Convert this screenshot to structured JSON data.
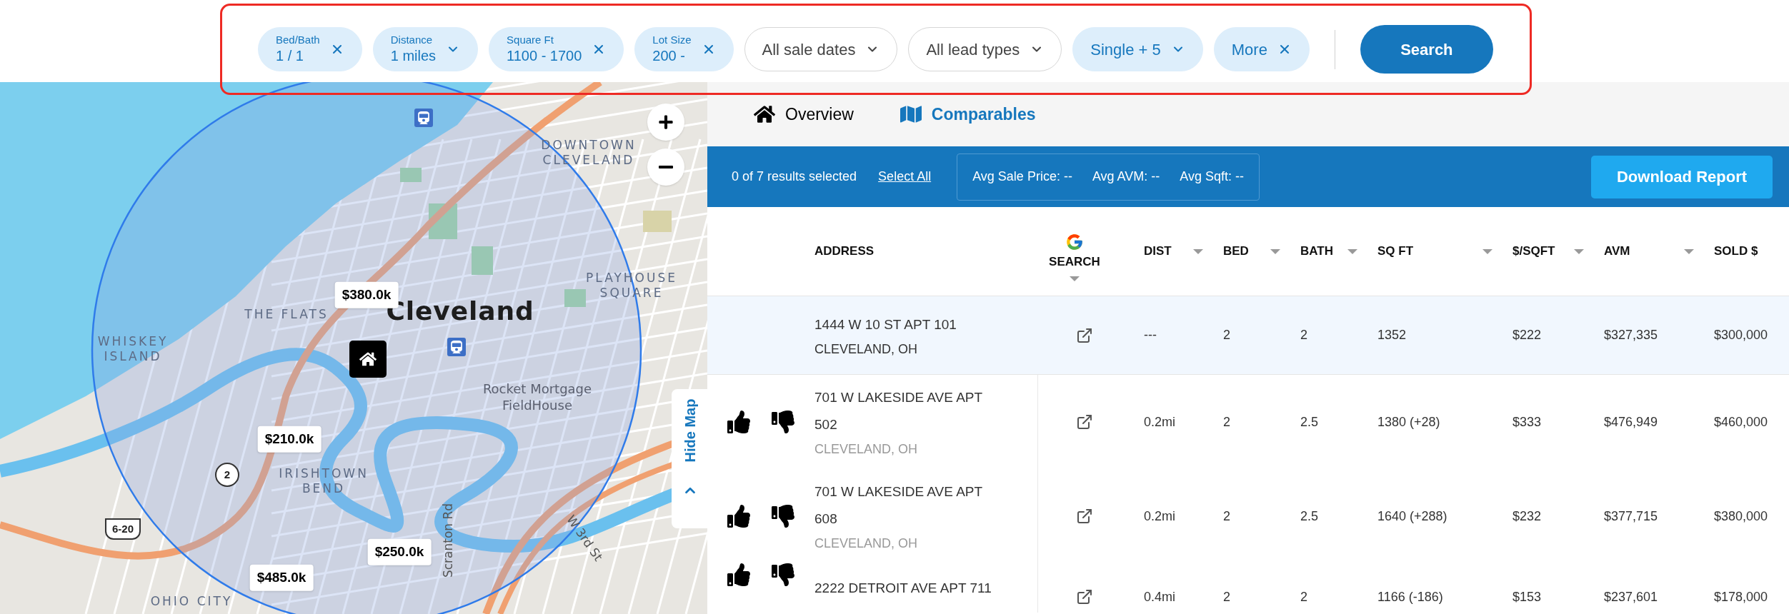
{
  "filters": [
    {
      "kind": "range",
      "label": "Bed/Bath",
      "value": "1 / 1",
      "active": true
    },
    {
      "kind": "picker",
      "label": "Distance",
      "value": "1 miles",
      "active": true
    },
    {
      "kind": "range",
      "label": "Square Ft",
      "value": "1100 - 1700",
      "active": true
    },
    {
      "kind": "range",
      "label": "Lot Size",
      "value": "200 -",
      "active": true
    },
    {
      "kind": "dropdown",
      "value": "All sale dates",
      "active": false
    },
    {
      "kind": "dropdown",
      "value": "All lead types",
      "active": false
    },
    {
      "kind": "dropdown",
      "value": "Single  + 5",
      "active": true
    },
    {
      "kind": "tag",
      "value": "More",
      "active": true
    }
  ],
  "search_button": "Search",
  "map": {
    "labels": [
      {
        "text": "Cleveland",
        "kind": "city"
      },
      {
        "text": "THE FLATS",
        "kind": "district"
      },
      {
        "text": "WHISKEY ISLAND",
        "kind": "district"
      },
      {
        "text": "DOWNTOWN CLEVELAND",
        "kind": "district"
      },
      {
        "text": "PLAYHOUSE SQUARE",
        "kind": "district"
      },
      {
        "text": "Rocket Mortgage FieldHouse",
        "kind": "poi"
      },
      {
        "text": "IRISHTOWN BEND",
        "kind": "district"
      },
      {
        "text": "OHIO CITY",
        "kind": "district"
      },
      {
        "text": "Scranton Rd",
        "kind": "street"
      },
      {
        "text": "W 3rd St",
        "kind": "street"
      }
    ],
    "shields": [
      {
        "text": "2",
        "kind": "state"
      },
      {
        "text": "6-20",
        "kind": "us"
      }
    ],
    "price_markers": [
      {
        "text": "$380.0k"
      },
      {
        "text": "$210.0k"
      },
      {
        "text": "$250.0k"
      },
      {
        "text": "$485.0k"
      }
    ],
    "hide_map": "Hide Map"
  },
  "tabs": [
    {
      "label": "Overview",
      "selected": false
    },
    {
      "label": "Comparables",
      "selected": true
    }
  ],
  "summary": {
    "selected_text": "0 of 7 results selected",
    "select_all": "Select All",
    "averages": [
      "Avg Sale Price: --",
      "Avg AVM: --",
      "Avg Sqft: --"
    ],
    "download": "Download Report"
  },
  "table": {
    "columns": [
      {
        "label": "ADDRESS",
        "kind": "text",
        "sortable": false
      },
      {
        "label": "SEARCH",
        "kind": "google",
        "sortable": true
      },
      {
        "label": "DIST",
        "kind": "text",
        "sortable": true
      },
      {
        "label": "BED",
        "kind": "text",
        "sortable": true
      },
      {
        "label": "BATH",
        "kind": "text",
        "sortable": true
      },
      {
        "label": "SQ FT",
        "kind": "text",
        "sortable": true
      },
      {
        "label": "$/SQFT",
        "kind": "text",
        "sortable": true
      },
      {
        "label": "AVM",
        "kind": "text",
        "sortable": true
      },
      {
        "label": "SOLD $",
        "kind": "text",
        "sortable": false
      }
    ],
    "rows": [
      {
        "kind": "subject",
        "street": "1444 W 10 ST APT 101",
        "city": "CLEVELAND, OH",
        "dist": "---",
        "bed": "2",
        "bath": "2",
        "sqft": "1352",
        "ppsf": "$222",
        "avm": "$327,335",
        "sold": "$300,000"
      },
      {
        "kind": "comp",
        "street": "701 W LAKESIDE AVE APT 502",
        "city": "CLEVELAND, OH",
        "dist": "0.2mi",
        "bed": "2",
        "bath": "2.5",
        "sqft": "1380 (+28)",
        "ppsf": "$333",
        "avm": "$476,949",
        "sold": "$460,000"
      },
      {
        "kind": "comp",
        "street": "701 W LAKESIDE AVE APT 608",
        "city": "CLEVELAND, OH",
        "dist": "0.2mi",
        "bed": "2",
        "bath": "2.5",
        "sqft": "1640 (+288)",
        "ppsf": "$232",
        "avm": "$377,715",
        "sold": "$380,000"
      },
      {
        "kind": "comp",
        "street": "2222 DETROIT AVE APT 711",
        "dist": "0.4mi",
        "bed": "2",
        "bath": "2",
        "sqft": "1166 (-186)",
        "ppsf": "$153",
        "avm": "$237,601",
        "sold": "$178,000"
      }
    ]
  }
}
